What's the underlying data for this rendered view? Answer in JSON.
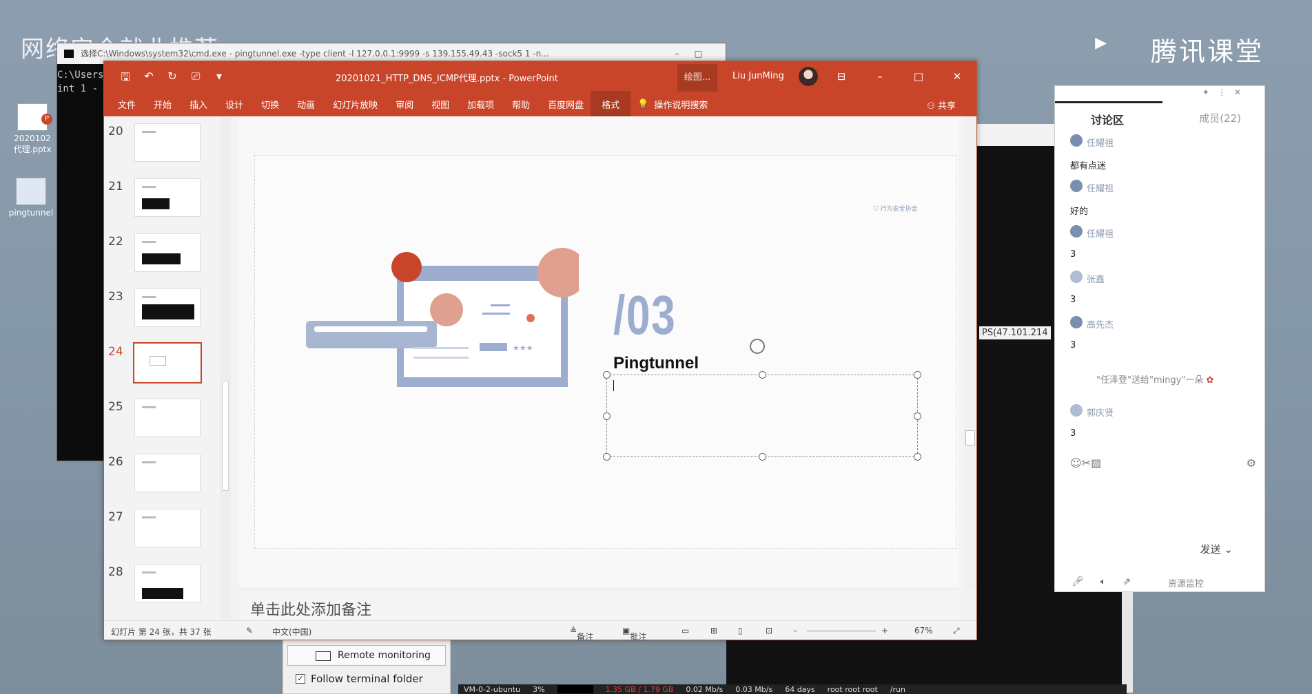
{
  "desktop": {
    "title": "网络安全就业推荐",
    "brand": "腾讯课堂",
    "icons": [
      {
        "label": "2020102\n代理.pptx"
      },
      {
        "label": "pingtunnel"
      }
    ]
  },
  "cmd": {
    "title": "选择C:\\Windows\\system32\\cmd.exe - pingtunnel.exe  -type client -l 127.0.0.1:9999 -s 139.155.49.43 -sock5 1 -n...",
    "lines": [
      "C:\\Users",
      "int 1 -"
    ]
  },
  "term2": {
    "ip_text": "PS(47.101.214"
  },
  "statusbar": {
    "host": "VM-0-2-ubuntu",
    "cpu": "3%",
    "mem": "1.35 GB / 1.79 GB",
    "up": "0.02 Mb/s",
    "down": "0.03 Mb/s",
    "uptime": "64 days",
    "user": "root  root  root",
    "path": "/run"
  },
  "remote": {
    "button": "Remote monitoring",
    "checkbox": "Follow terminal folder",
    "checked": true
  },
  "ppt": {
    "doc_title": "20201021_HTTP_DNS_ICMP代理.pptx  -  PowerPoint",
    "context_tab": "绘图...",
    "user": "Liu JunMing",
    "menu": [
      "文件",
      "开始",
      "插入",
      "设计",
      "切换",
      "动画",
      "幻灯片放映",
      "审阅",
      "视图",
      "加载项",
      "帮助",
      "百度网盘",
      "格式"
    ],
    "active_menu": "格式",
    "tell_me": "操作说明搜索",
    "share": "共享",
    "thumbnails": [
      "20",
      "21",
      "22",
      "23",
      "24",
      "25",
      "26",
      "27",
      "28"
    ],
    "selected_slide": "24",
    "slide": {
      "logo_text": "行为安全协会",
      "number": "/03",
      "title": "Pingtunnel"
    },
    "notes_placeholder": "单击此处添加备注",
    "status": {
      "slide_info": "幻灯片 第 24 张，共 37 张",
      "language": "中文(中国)",
      "notes": "备注",
      "comments": "批注",
      "zoom": "67%"
    }
  },
  "chat": {
    "tab_discussion": "讨论区",
    "tab_members": "成员(22)",
    "messages": [
      {
        "who": "任耀祖",
        "text": "都有点迷"
      },
      {
        "who": "任耀祖",
        "text": "好的"
      },
      {
        "who": "任耀祖",
        "text": "3"
      },
      {
        "who": "张鑫",
        "text": "3"
      },
      {
        "who": "高先杰",
        "text": "3"
      },
      {
        "who": "郭庆贤",
        "text": "3"
      }
    ],
    "gift": "\"任泽登\"送给\"mingy\"一朵",
    "send": "发送",
    "monitor": "资源监控"
  }
}
